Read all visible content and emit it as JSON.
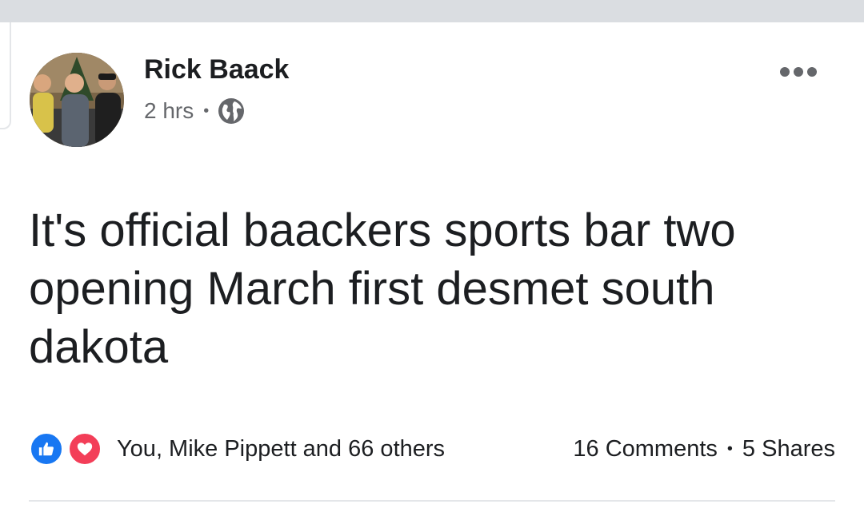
{
  "post": {
    "author": "Rick Baack",
    "time": "2 hrs",
    "separator": "•",
    "privacy_icon": "globe-icon",
    "more_icon": "more-horizontal-icon",
    "text": "It's official baackers sports bar two opening March first desmet south dakota"
  },
  "engagement": {
    "reaction_icons": [
      "like-icon",
      "love-icon"
    ],
    "reactors": "You, Mike Pippett and 66 others",
    "comments": "16 Comments",
    "separator": "•",
    "shares": "5 Shares"
  },
  "colors": {
    "like": "#1877f2",
    "love": "#f33e58",
    "text": "#1c1e21",
    "secondary": "#65676b",
    "topbar": "#dadde1"
  }
}
